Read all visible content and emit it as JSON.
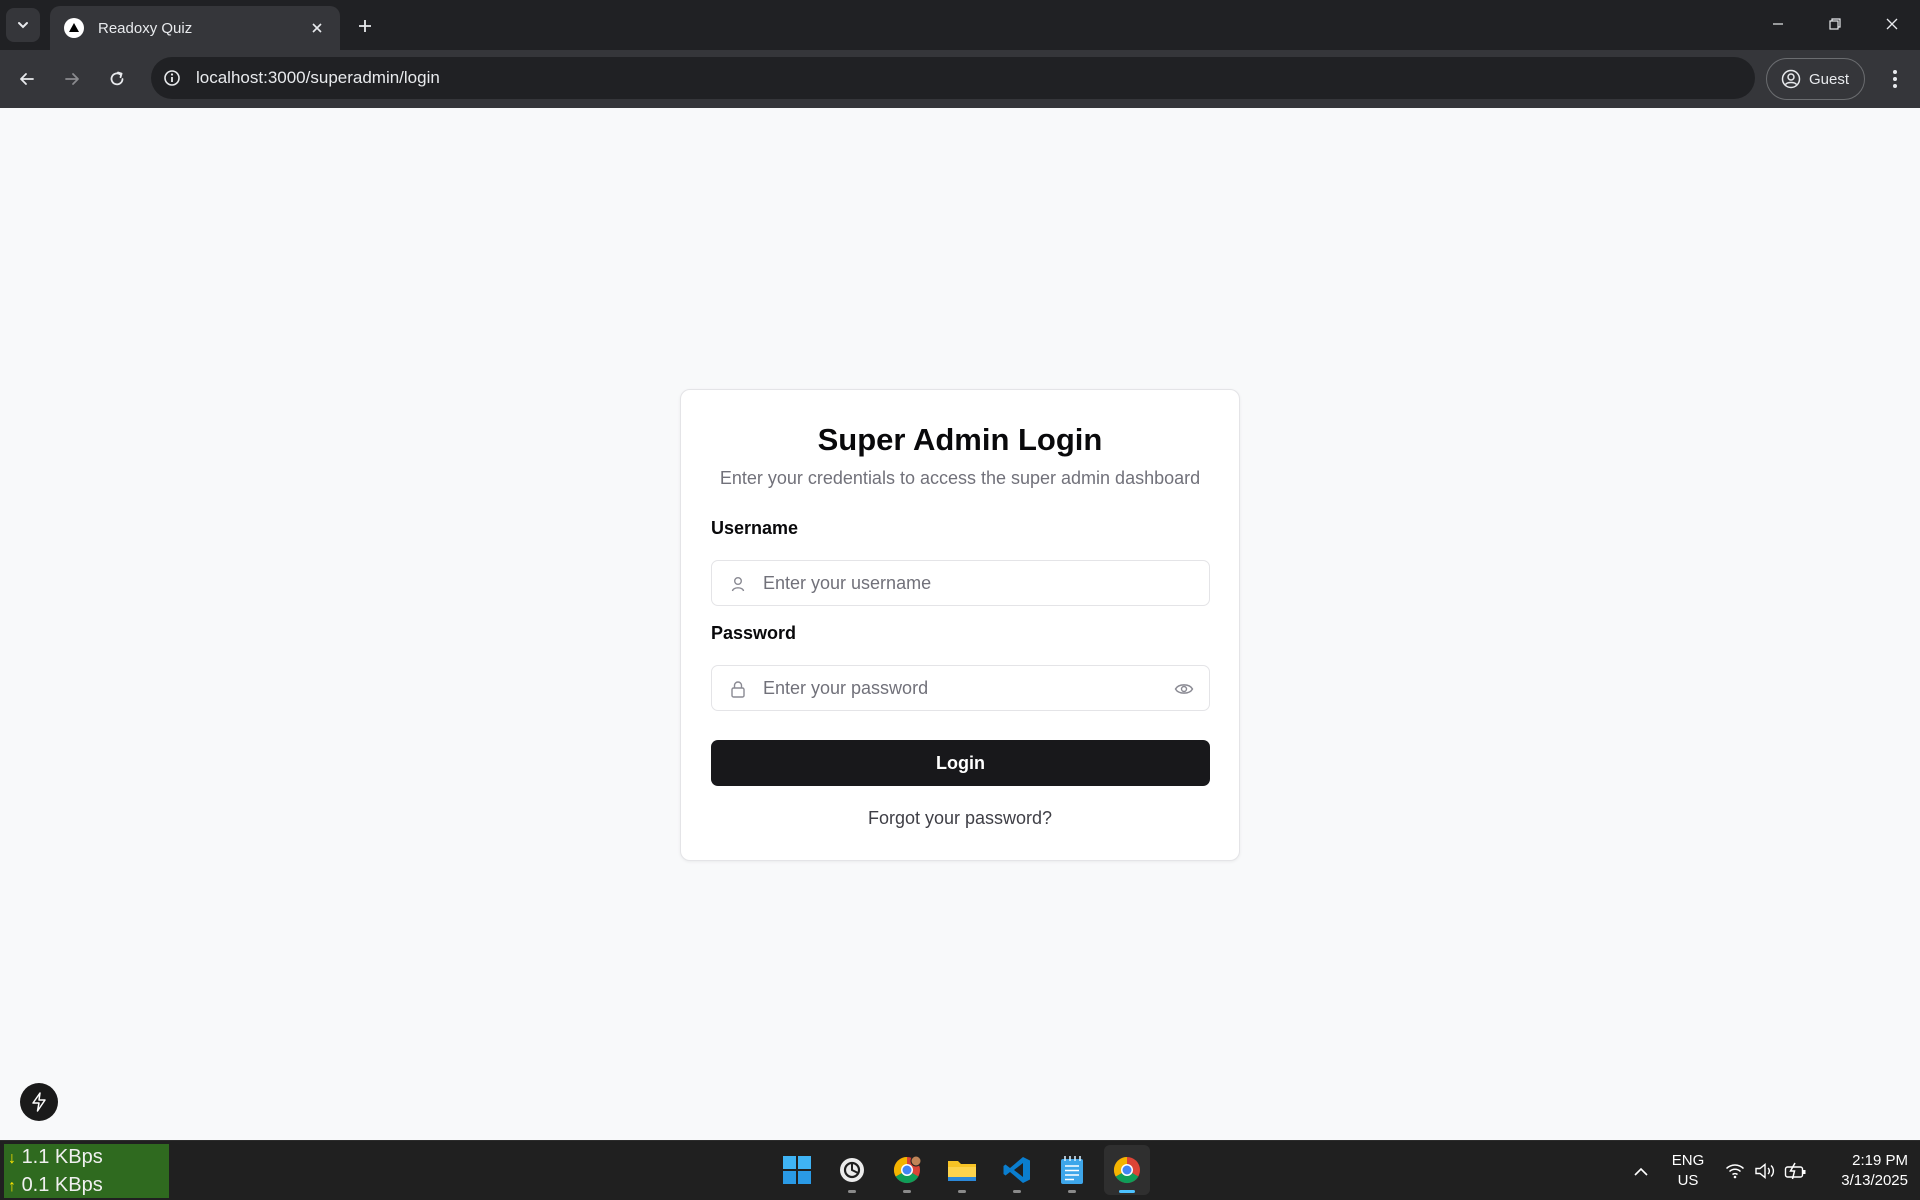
{
  "browser": {
    "tab": {
      "title": "Readoxy Quiz"
    },
    "address_bar": {
      "url": "localhost:3000/superadmin/login"
    },
    "profile": {
      "label": "Guest"
    }
  },
  "login_card": {
    "title": "Super Admin Login",
    "subtitle": "Enter your credentials to access the super admin dashboard",
    "username": {
      "label": "Username",
      "placeholder": "Enter your username",
      "value": ""
    },
    "password": {
      "label": "Password",
      "placeholder": "Enter your password",
      "value": ""
    },
    "login_button": "Login",
    "forgot_link": "Forgot your password?"
  },
  "taskbar": {
    "network": {
      "down": "1.1 KBps",
      "up": "0.1 KBps"
    },
    "language": {
      "line1": "ENG",
      "line2": "US"
    },
    "clock": {
      "time": "2:19 PM",
      "date": "3/13/2025"
    },
    "apps": [
      "windows-start",
      "chatgpt",
      "chrome-profile",
      "file-explorer",
      "vscode",
      "notepad",
      "chrome"
    ]
  },
  "colors": {
    "page_background": "#f8f9fa",
    "button_primary": "#18181b",
    "taskbar_active": "#4cc2ff",
    "network_monitor": "#2f6a1f"
  }
}
